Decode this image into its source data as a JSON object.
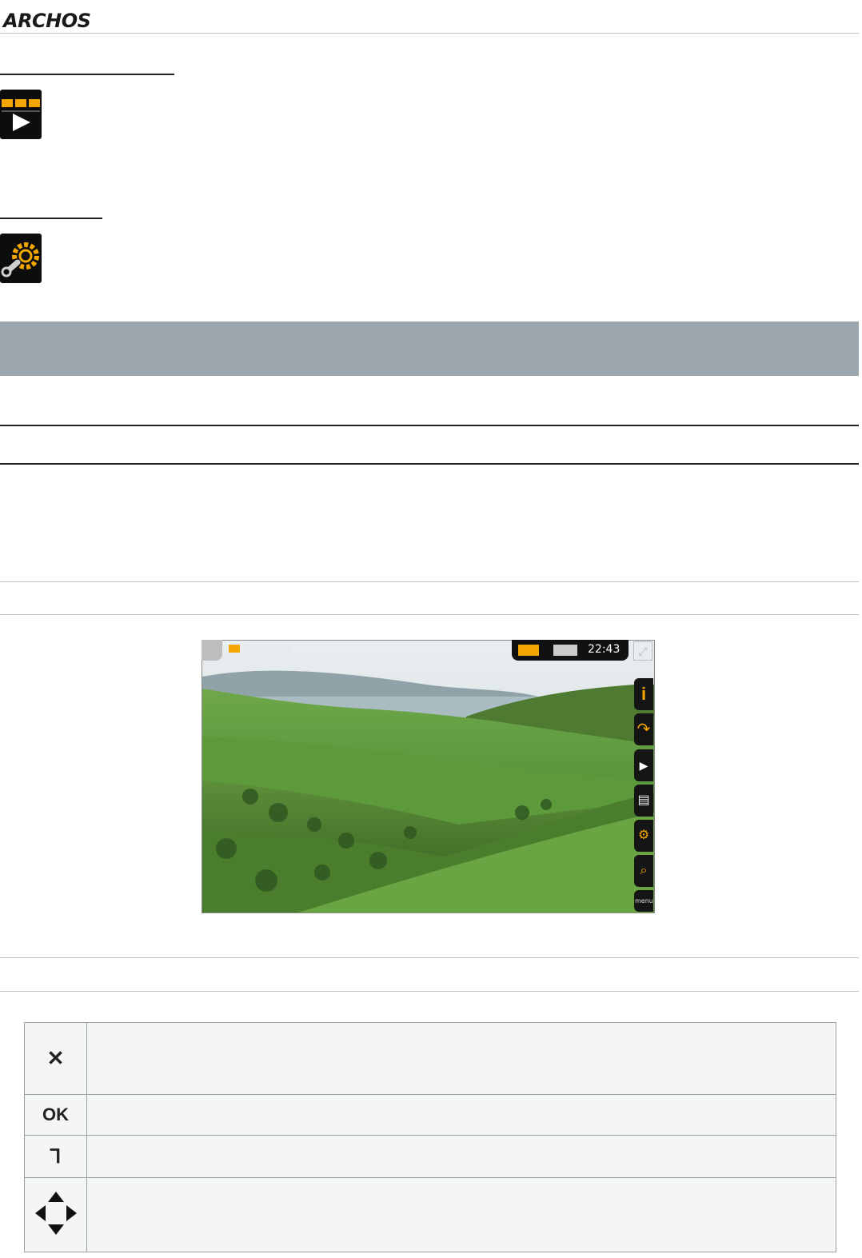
{
  "header": {
    "logo_text": "ARCHOS"
  },
  "icons": {
    "slideshow": "slideshow-icon",
    "settings": "settings-icon"
  },
  "photo_viewer": {
    "title": "Photo_01",
    "clock": "22:43",
    "menu_label": "menu",
    "side_buttons": [
      "info-icon",
      "rotate-icon",
      "slideshow-icon",
      "set-wallpaper-icon",
      "settings-icon",
      "zoom-icon",
      "menu-icon"
    ]
  },
  "key_table": {
    "rows": [
      {
        "key_label": "✕",
        "icon": "close-icon",
        "text": ""
      },
      {
        "key_label": "OK",
        "icon": "ok-icon",
        "text": ""
      },
      {
        "key_label": "⅂",
        "icon": "back-icon",
        "text": ""
      },
      {
        "key_label": "",
        "icon": "directional-arrows-icon",
        "text": ""
      }
    ]
  },
  "colors": {
    "banner": "#9ca6ad",
    "icon_accent": "#f3a600",
    "table_bg": "#f4f5f5"
  }
}
